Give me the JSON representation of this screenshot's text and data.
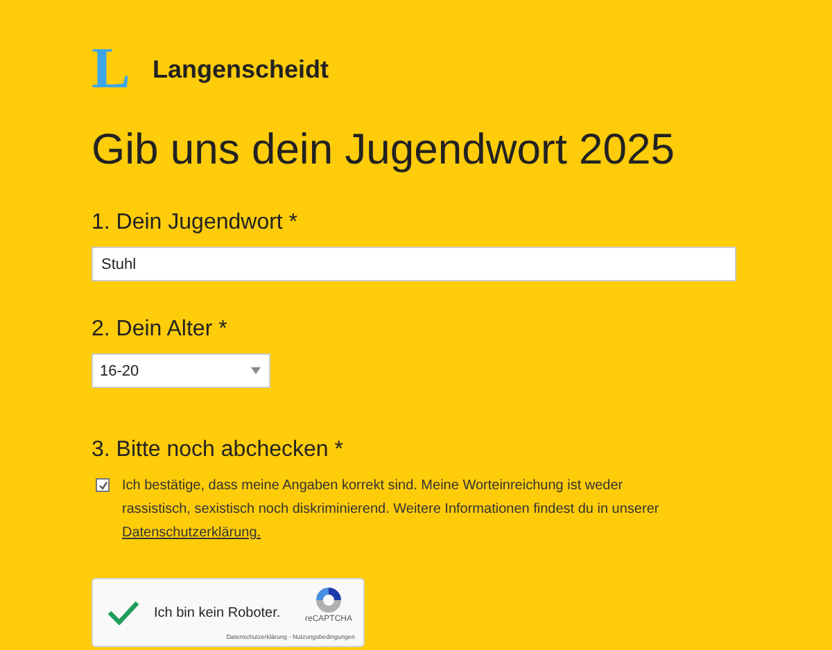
{
  "logo": {
    "letter": "L",
    "name": "Langenscheidt"
  },
  "title": "Gib uns dein Jugendwort 2025",
  "fields": [
    {
      "kind": "text",
      "label": "1. Dein Jugendwort *",
      "value": "Stuhl"
    },
    {
      "kind": "select",
      "label": "2. Dein Alter *",
      "value": "16-20"
    },
    {
      "kind": "consent",
      "label": "3. Bitte noch abchecken *",
      "checked": true,
      "text": "Ich bestätige, dass meine Angaben korrekt sind. Meine Worteinreichung ist weder rassistisch, sexistisch noch diskriminierend. Weitere Informationen findest du in unserer ",
      "link": "Datenschutzerklärung."
    }
  ],
  "captcha": {
    "verified": true,
    "label": "Ich bin kein Roboter.",
    "brand": "reCAPTCHA",
    "links": "Datenschutzerklärung - Nutzungsbedingungen"
  }
}
